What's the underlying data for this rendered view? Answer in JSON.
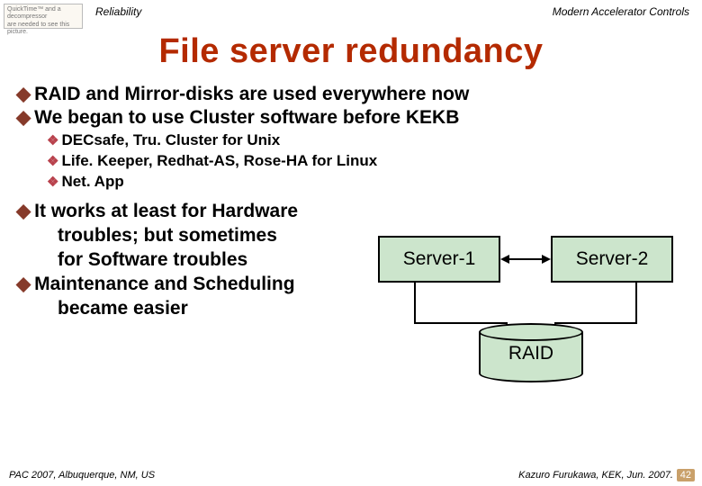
{
  "header": {
    "placeholder_line1": "QuickTime™ and a",
    "placeholder_line2": "decompressor",
    "placeholder_line3": "are needed to see this picture.",
    "left": "Reliability",
    "right": "Modern Accelerator Controls"
  },
  "title": "File server redundancy",
  "bullets": {
    "b1": "RAID and Mirror-disks are used everywhere now",
    "b2": "We began to use Cluster software before KEKB",
    "s1": "DECsafe, Tru. Cluster for Unix",
    "s2": "Life. Keeper, Redhat-AS, Rose-HA for Linux",
    "s3": "Net. App",
    "b3a": "It works at least for Hardware",
    "b3b": "troubles; but sometimes",
    "b3c": "for Software troubles",
    "b4a": "Maintenance and Scheduling",
    "b4b": "became easier"
  },
  "diagram": {
    "server1": "Server-1",
    "server2": "Server-2",
    "raid": "RAID"
  },
  "footer": {
    "left": "PAC 2007, Albuquerque, NM, US",
    "right": "Kazuro Furukawa, KEK, Jun. 2007.",
    "page": "42"
  }
}
